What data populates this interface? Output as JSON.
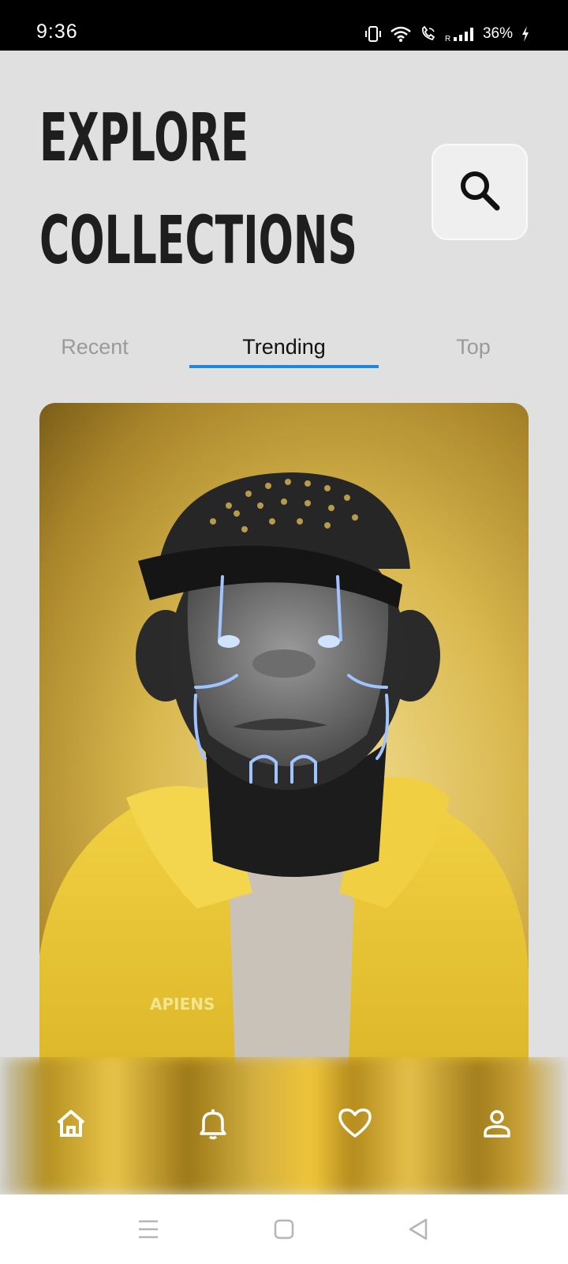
{
  "status_bar": {
    "time": "9:36",
    "battery": "36%"
  },
  "header": {
    "title_line1": "EXPLORE",
    "title_line2": "COLLECTIONS"
  },
  "tabs": [
    {
      "label": "Recent",
      "active": false
    },
    {
      "label": "Trending",
      "active": true
    },
    {
      "label": "Top",
      "active": false
    }
  ],
  "card": {
    "jacket_text": "APIENS"
  },
  "bottom_nav": {
    "items": [
      "home-icon",
      "bell-icon",
      "heart-icon",
      "profile-icon"
    ]
  },
  "colors": {
    "accent": "#1e88e5",
    "background": "#e0e0e0",
    "title": "#1e1e1e"
  }
}
